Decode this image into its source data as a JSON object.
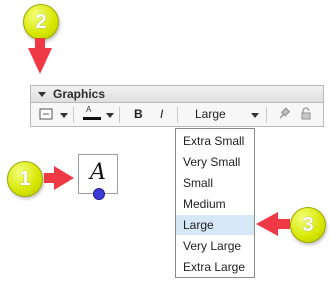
{
  "panel": {
    "title": "Graphics"
  },
  "toolbar": {
    "line_color_label": "A",
    "bold_label": "B",
    "italic_label": "I",
    "size_value": "Large"
  },
  "canvas": {
    "text_object_glyph": "A"
  },
  "dropdown": {
    "items": [
      "Extra Small",
      "Very Small",
      "Small",
      "Medium",
      "Large",
      "Very Large",
      "Extra Large"
    ],
    "selected_index": 4
  },
  "annotations": {
    "badge_1": "1",
    "badge_2": "2",
    "badge_3": "3"
  },
  "colors": {
    "accent": "#ef3a46",
    "badge": "#d6e600",
    "selected_item": "#d6e7f6",
    "point_handle": "#3b3bd8"
  }
}
